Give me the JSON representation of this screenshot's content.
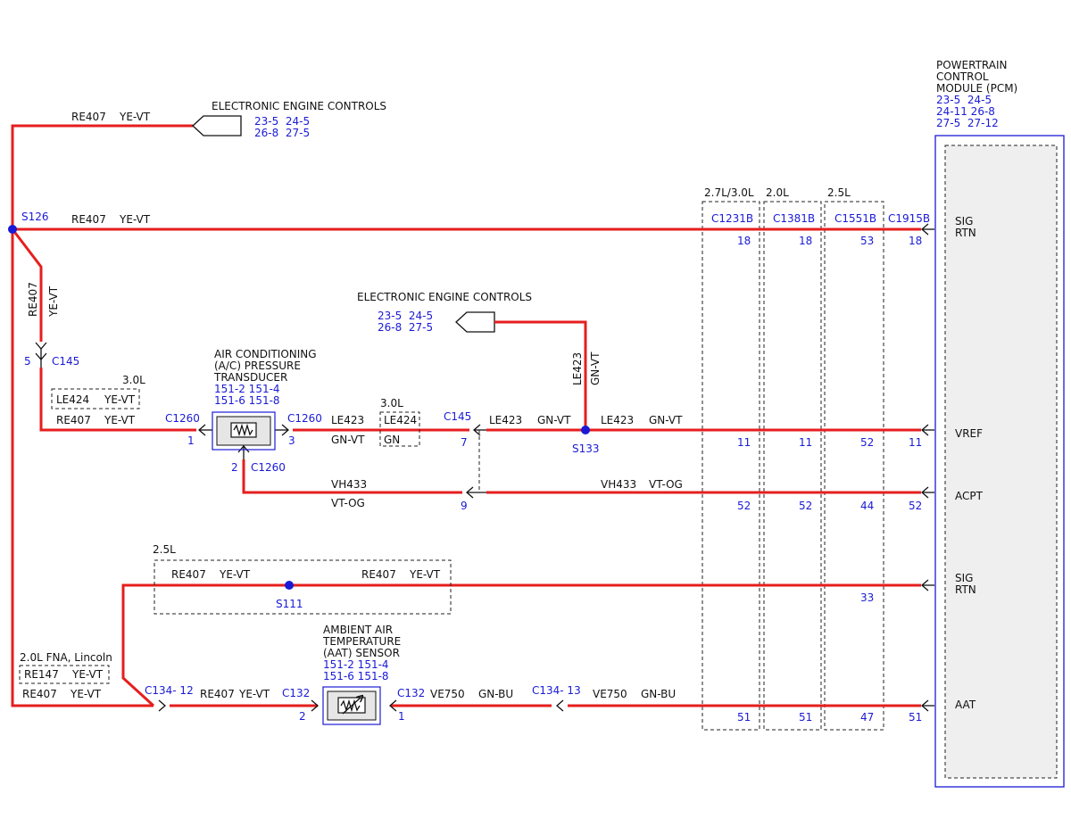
{
  "colors": {
    "wire": "#e61e1e",
    "label_blue": "#1a1ad6",
    "pcm_fill": "#efefef",
    "component_border": "#1a1ad6"
  },
  "pcm": {
    "title": [
      "POWERTRAIN",
      "CONTROL",
      "MODULE (PCM)"
    ],
    "refs": [
      "23-5  24-5",
      "24-11 26-8",
      "27-5  27-12"
    ],
    "pins": {
      "sig_rtn_1": [
        "SIG",
        "RTN"
      ],
      "vref": "VREF",
      "acpt": "ACPT",
      "sig_rtn_2": [
        "SIG",
        "RTN"
      ],
      "aat": "AAT"
    }
  },
  "eec_top": {
    "title": "ELECTRONIC ENGINE CONTROLS",
    "refs": [
      "23-5  24-5",
      "26-8  27-5"
    ]
  },
  "eec_mid": {
    "title": "ELECTRONIC ENGINE CONTROLS",
    "refs": [
      "23-5  24-5",
      "26-8  27-5"
    ]
  },
  "engine_groups": {
    "g1": "2.7L/3.0L",
    "g2": "2.0L",
    "g3": "2.5L"
  },
  "connectors": {
    "c1231b": {
      "name": "C1231B",
      "pins": [
        "18",
        "11",
        "52",
        "51"
      ]
    },
    "c1381b": {
      "name": "C1381B",
      "pins": [
        "18",
        "11",
        "52",
        "51"
      ]
    },
    "c1551b": {
      "name": "C1551B",
      "pins": [
        "53",
        "52",
        "44",
        "33",
        "47"
      ]
    },
    "c1915b": {
      "name": "C1915B",
      "pins": [
        "18",
        "11",
        "52",
        "51"
      ]
    }
  },
  "wires": {
    "top_eec": {
      "circuit": "RE407",
      "color": "YE-VT"
    },
    "sig_rtn_main": {
      "circuit": "RE407",
      "color": "YE-VT"
    },
    "vertical_drop": {
      "circuit": "RE407",
      "color": "YE-VT"
    },
    "to_acpt_sensor": {
      "circuit": "RE407",
      "color": "YE-VT"
    },
    "le423_right": {
      "circuit": "LE423",
      "color": "GN-VT"
    },
    "le423_mid": {
      "circuit": "LE423",
      "color": "GN-VT"
    },
    "le423_left": {
      "circuit": "LE423",
      "color": "GN-VT"
    },
    "le423_vertical": {
      "circuit": "LE423",
      "color": "GN-VT"
    },
    "vh433_left": {
      "circuit": "VH433",
      "color": "VT-OG"
    },
    "vh433_right": {
      "circuit": "VH433",
      "color": "VT-OG"
    },
    "s111_left": {
      "circuit": "RE407",
      "color": "YE-VT"
    },
    "s111_right": {
      "circuit": "RE407",
      "color": "YE-VT"
    },
    "bottom_left": {
      "circuit": "RE407",
      "color": "YE-VT"
    },
    "bottom_mid": {
      "circuit": "RE407",
      "color": "YE-VT"
    },
    "ve750_left": {
      "circuit": "VE750",
      "color": "GN-BU"
    },
    "ve750_right": {
      "circuit": "VE750",
      "color": "GN-BU"
    }
  },
  "alt_boxes": {
    "le424_30l_a": {
      "engine": "3.0L",
      "circuit": "LE424",
      "color": "YE-VT"
    },
    "le424_30l_b": {
      "engine": "3.0L",
      "circuit": "LE424",
      "color": "GN"
    },
    "s111_group": {
      "engine": "2.5L"
    },
    "fna_lincoln": {
      "engine": "2.0L FNA, Lincoln",
      "circuit": "RE147",
      "color": "YE-VT"
    }
  },
  "splices": {
    "s126": "S126",
    "s133": "S133",
    "s111": "S111"
  },
  "c145_top": {
    "pin": "5",
    "name": "C145"
  },
  "c145_mid": {
    "name": "C145",
    "pin_a": "7",
    "pin_b": "9"
  },
  "acpt_sensor": {
    "title": [
      "AIR CONDITIONING",
      "(A/C) PRESSURE",
      "TRANSDUCER"
    ],
    "refs": [
      "151-2 151-4",
      "151-6 151-8"
    ],
    "left_connector": "C1260",
    "left_pin": "1",
    "right_connector": "C1260",
    "right_pin": "3",
    "bottom_connector": "C1260",
    "bottom_pin": "2"
  },
  "aat_sensor": {
    "title": [
      "AMBIENT AIR",
      "TEMPERATURE",
      "(AAT) SENSOR"
    ],
    "refs": [
      "151-2 151-4",
      "151-6 151-8"
    ],
    "left_connector": "C132",
    "left_pin": "2",
    "right_connector": "C132",
    "right_pin": "1"
  },
  "c134_left": {
    "name": "C134- 12"
  },
  "c134_right": {
    "name": "C134- 13"
  }
}
